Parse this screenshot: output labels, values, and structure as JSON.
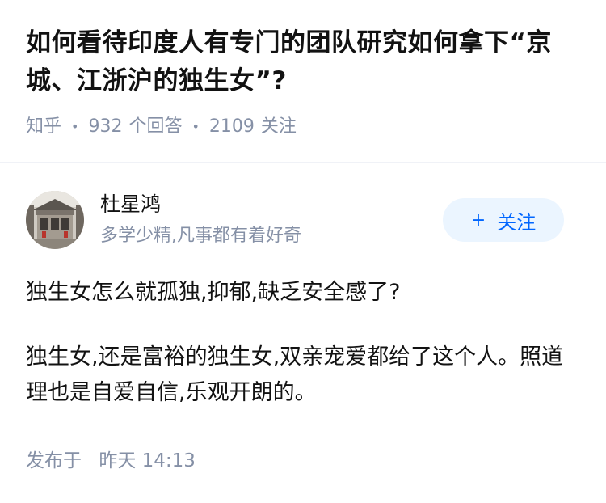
{
  "question": {
    "title": "如何看待印度人有专门的团队研究如何拿下“京城、江浙沪的独生女”?",
    "source": "知乎",
    "answers_count": "932",
    "answers_label": "个回答",
    "followers_count": "2109",
    "followers_label": "关注"
  },
  "author": {
    "name": "杜星鸿",
    "bio": "多学少精,凡事都有着好奇",
    "avatar_icon": "author-avatar",
    "follow_label": "关注",
    "follow_plus": "+"
  },
  "answer": {
    "paragraphs": [
      "独生女怎么就孤独,抑郁,缺乏安全感了?",
      "独生女,还是富裕的独生女,双亲宠爱都给了这个人。照道理也是自爱自信,乐观开朗的。"
    ],
    "publish_label": "发布于",
    "publish_time": "昨天 14:13"
  },
  "colors": {
    "text": "#121212",
    "meta": "#8590a6",
    "accent": "#0066ff",
    "follow_bg": "#ebf5ff"
  }
}
